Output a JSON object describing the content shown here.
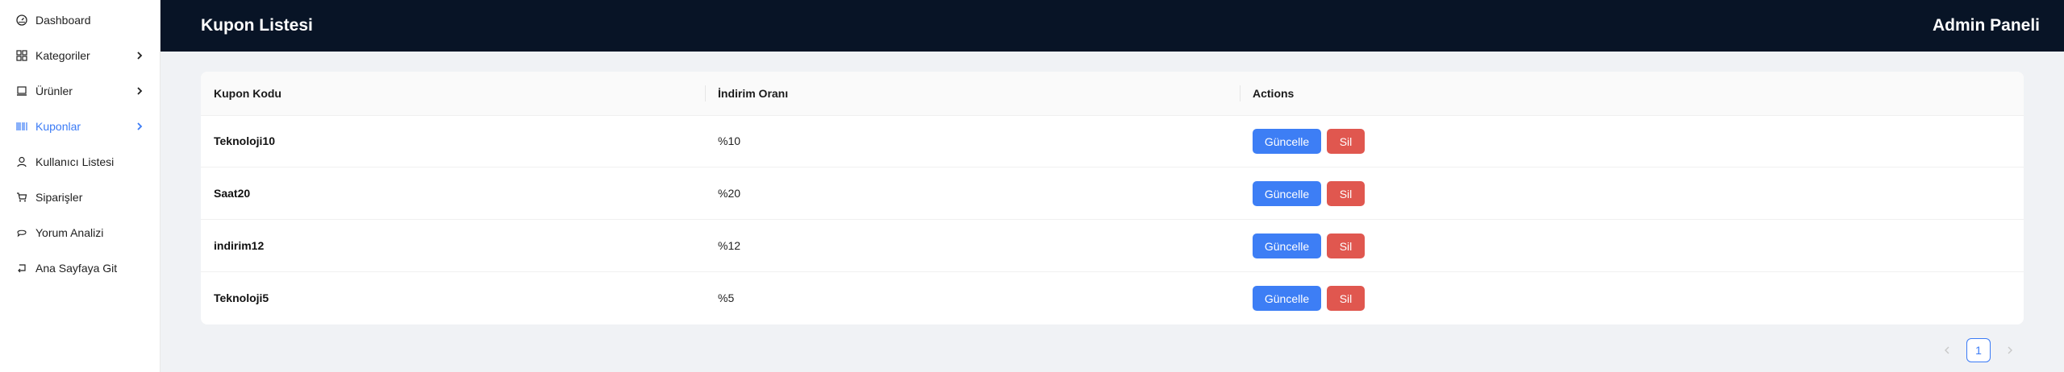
{
  "sidebar": {
    "items": [
      {
        "label": "Dashboard",
        "icon": "dashboard-icon"
      },
      {
        "label": "Kategoriler",
        "icon": "grid-icon",
        "has_submenu": true
      },
      {
        "label": "Ürünler",
        "icon": "laptop-icon",
        "has_submenu": true
      },
      {
        "label": "Kuponlar",
        "icon": "barcode-icon",
        "has_submenu": true,
        "active": true
      },
      {
        "label": "Kullanıcı Listesi",
        "icon": "user-icon"
      },
      {
        "label": "Siparişler",
        "icon": "cart-icon"
      },
      {
        "label": "Yorum Analizi",
        "icon": "comments-icon"
      },
      {
        "label": "Ana Sayfaya Git",
        "icon": "rollback-icon"
      }
    ]
  },
  "header": {
    "title": "Kupon Listesi",
    "right_title": "Admin Paneli"
  },
  "table": {
    "columns": [
      "Kupon Kodu",
      "İndirim Oranı",
      "Actions"
    ],
    "rows": [
      {
        "code": "Teknoloji10",
        "discount": "%10"
      },
      {
        "code": "Saat20",
        "discount": "%20"
      },
      {
        "code": "indirim12",
        "discount": "%12"
      },
      {
        "code": "Teknoloji5",
        "discount": "%5"
      }
    ],
    "update_label": "Güncelle",
    "delete_label": "Sil"
  },
  "pagination": {
    "current_page": "1"
  },
  "colors": {
    "header_bg": "#081426",
    "accent": "#3b7bf6",
    "update_button": "#3d7ef5",
    "delete_button": "#e0574f"
  }
}
